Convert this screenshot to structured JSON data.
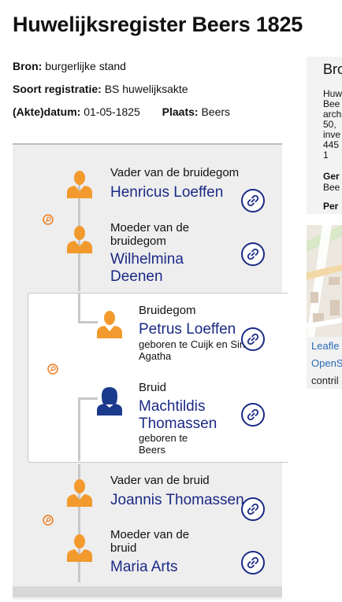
{
  "page_title": "Huwelijksregister Beers 1825",
  "meta": {
    "bron_label": "Bron:",
    "bron_value": "burgerlijke stand",
    "soort_label": "Soort registratie:",
    "soort_value": "BS huwelijksakte",
    "datum_label": "(Akte)datum:",
    "datum_value": "01-05-1825",
    "plaats_label": "Plaats:",
    "plaats_value": "Beers"
  },
  "persons": {
    "groom_father": {
      "role": "Vader van de bruidegom",
      "name": "Henricus Loeffen"
    },
    "groom_mother": {
      "role_1": "Moeder van de",
      "role_2": "bruidegom",
      "name_1": "Wilhelmina",
      "name_2": "Deenen"
    },
    "groom": {
      "role": "Bruidegom",
      "name": "Petrus Loeffen",
      "birth_1": "geboren te Cuijk en Sint",
      "birth_2": "Agatha"
    },
    "bride": {
      "role": "Bruid",
      "name_1": "Machtildis",
      "name_2": "Thomassen",
      "birth_1": "geboren te",
      "birth_2": "Beers"
    },
    "bride_father": {
      "role": "Vader van de bruid",
      "name": "Joannis Thomassen"
    },
    "bride_mother": {
      "role_1": "Moeder van de",
      "role_2": "bruid",
      "name": "Maria Arts"
    }
  },
  "sidebar": {
    "title": "Bro",
    "lines": [
      "Huw",
      "Bee",
      "arch",
      "50,",
      "inve",
      "445",
      "1"
    ],
    "gem_label": "Ger",
    "gem_value": "Bee",
    "per_label": "Per"
  },
  "map": {
    "leaflet": "Leafle",
    "osm": "OpenS",
    "contrib": "contril"
  },
  "colors": {
    "male_icon": "#f29a2e",
    "female_icon": "#1b3a8c",
    "name_text": "#1b2a86",
    "search_icon": "#f07a1a"
  },
  "icons": {
    "male": "person-male-icon",
    "female": "person-female-icon",
    "link": "link-icon",
    "search": "search-icon"
  }
}
